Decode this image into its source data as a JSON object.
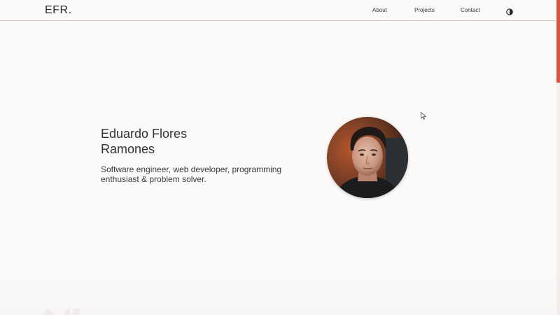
{
  "header": {
    "brand": "EFR.",
    "nav": [
      {
        "label": "About"
      },
      {
        "label": "Projects"
      },
      {
        "label": "Contact"
      }
    ],
    "theme_toggle_icon": "contrast-icon"
  },
  "hero": {
    "name_line1": "Eduardo Flores",
    "name_line2": "Ramones",
    "tagline": "Software engineer, web developer, programming enthusiast & problem solver.",
    "avatar_icon": "profile-photo"
  },
  "colors": {
    "accent": "#d9563e",
    "background": "#fbfaf9",
    "text": "#2e2e2e"
  }
}
